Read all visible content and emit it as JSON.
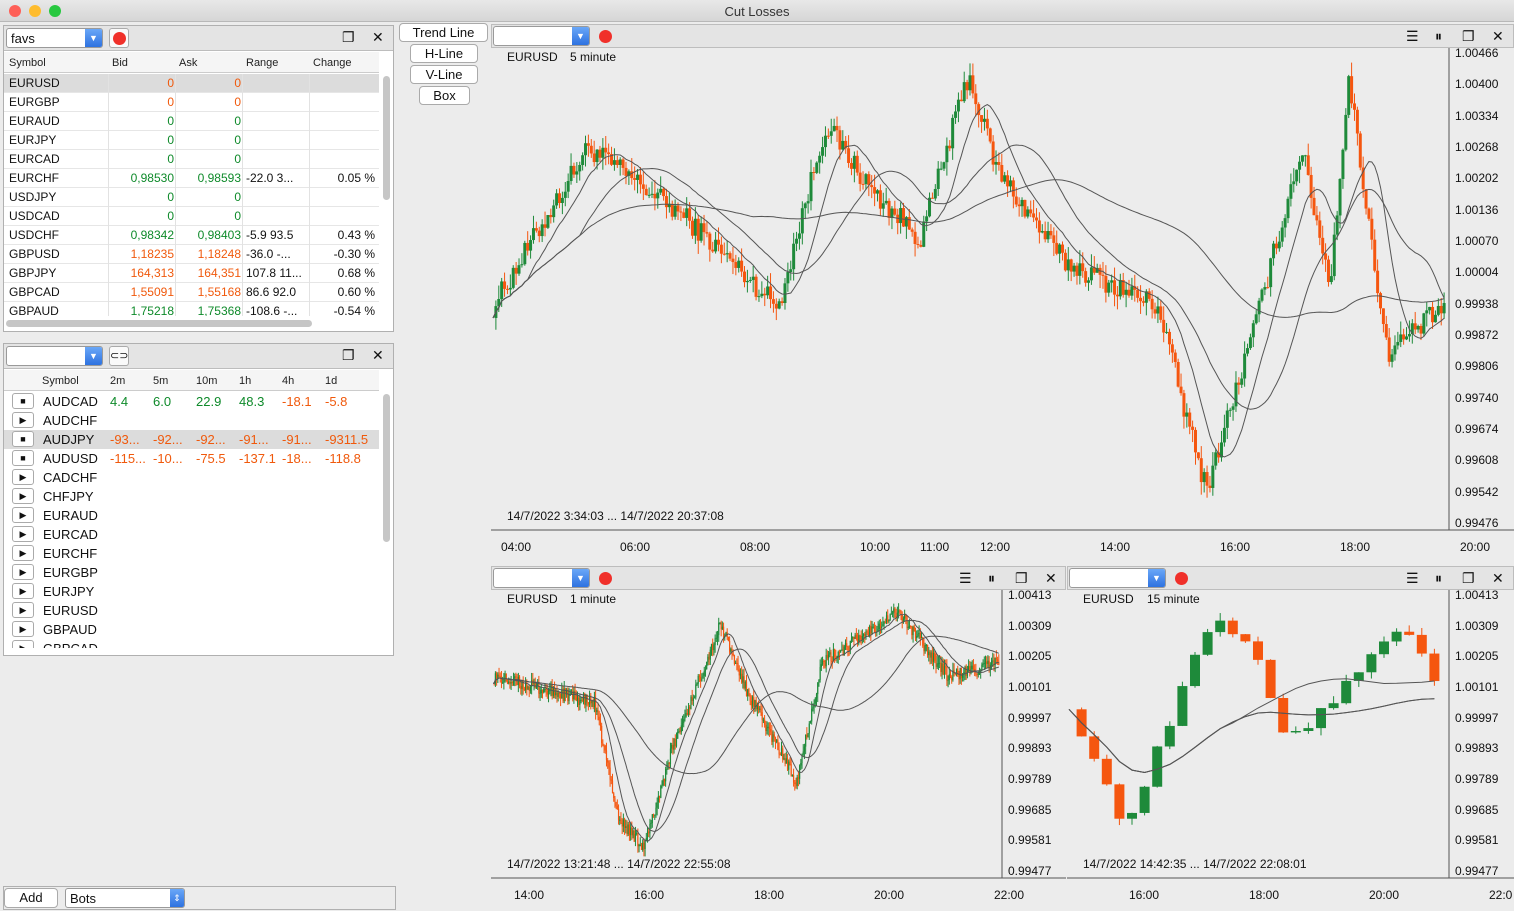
{
  "window": {
    "title": "Cut Losses"
  },
  "favs": {
    "dropdown_value": "favs",
    "columns": [
      "Symbol",
      "Bid",
      "Ask",
      "Range",
      "Change"
    ],
    "rows": [
      {
        "symbol": "EURUSD",
        "bid": "0",
        "ask": "0",
        "range": "",
        "change": "",
        "color": "o"
      },
      {
        "symbol": "EURGBP",
        "bid": "0",
        "ask": "0",
        "range": "",
        "change": "",
        "color": "o"
      },
      {
        "symbol": "EURAUD",
        "bid": "0",
        "ask": "0",
        "range": "",
        "change": "",
        "color": "g"
      },
      {
        "symbol": "EURJPY",
        "bid": "0",
        "ask": "0",
        "range": "",
        "change": "",
        "color": "g"
      },
      {
        "symbol": "EURCAD",
        "bid": "0",
        "ask": "0",
        "range": "",
        "change": "",
        "color": "g"
      },
      {
        "symbol": "EURCHF",
        "bid": "0,98530",
        "ask": "0,98593",
        "range": "-22.0 3...",
        "change": "0.05 %",
        "color": "g"
      },
      {
        "symbol": "USDJPY",
        "bid": "0",
        "ask": "0",
        "range": "",
        "change": "",
        "color": "g"
      },
      {
        "symbol": "USDCAD",
        "bid": "0",
        "ask": "0",
        "range": "",
        "change": "",
        "color": "g"
      },
      {
        "symbol": "USDCHF",
        "bid": "0,98342",
        "ask": "0,98403",
        "range": "-5.9 93.5",
        "change": "0.43 %",
        "color": "g"
      },
      {
        "symbol": "GBPUSD",
        "bid": "1,18235",
        "ask": "1,18248",
        "range": "-36.0 -...",
        "change": "-0.30 %",
        "color": "o"
      },
      {
        "symbol": "GBPJPY",
        "bid": "164,313",
        "ask": "164,351",
        "range": "107.8 11...",
        "change": "0.68 %",
        "color": "o"
      },
      {
        "symbol": "GBPCAD",
        "bid": "1,55091",
        "ask": "1,55168",
        "range": "86.6 92.0",
        "change": "0.60 %",
        "color": "o"
      },
      {
        "symbol": "GBPAUD",
        "bid": "1,75218",
        "ask": "1,75368",
        "range": "-108.6 -...",
        "change": "-0.54 %",
        "color": "g"
      }
    ]
  },
  "scanner": {
    "dropdown_value": "",
    "columns": [
      "Symbol",
      "2m",
      "5m",
      "10m",
      "1h",
      "4h",
      "1d"
    ],
    "rows": [
      {
        "state": "stop",
        "symbol": "AUDCAD",
        "v": [
          "4.4",
          "6.0",
          "22.9",
          "48.3",
          "-18.1",
          "-5.8"
        ],
        "c": [
          "g",
          "g",
          "g",
          "g",
          "o",
          "o"
        ]
      },
      {
        "state": "play",
        "symbol": "AUDCHF",
        "v": [
          "",
          "",
          "",
          "",
          "",
          ""
        ],
        "c": [
          "g",
          "g",
          "g",
          "g",
          "g",
          "g"
        ]
      },
      {
        "state": "stop",
        "symbol": "AUDJPY",
        "v": [
          "-93...",
          "-92...",
          "-92...",
          "-91...",
          "-91...",
          "-9311.5"
        ],
        "c": [
          "o",
          "o",
          "o",
          "o",
          "o",
          "o"
        ]
      },
      {
        "state": "stop",
        "symbol": "AUDUSD",
        "v": [
          "-115...",
          "-10...",
          "-75.5",
          "-137.1",
          "-18...",
          "-118.8"
        ],
        "c": [
          "o",
          "o",
          "o",
          "o",
          "o",
          "o"
        ]
      },
      {
        "state": "play",
        "symbol": "CADCHF",
        "v": [
          "",
          "",
          "",
          "",
          "",
          ""
        ],
        "c": [
          "g",
          "g",
          "g",
          "g",
          "g",
          "g"
        ]
      },
      {
        "state": "play",
        "symbol": "CHFJPY",
        "v": [
          "",
          "",
          "",
          "",
          "",
          ""
        ],
        "c": [
          "g",
          "g",
          "g",
          "g",
          "g",
          "g"
        ]
      },
      {
        "state": "play",
        "symbol": "EURAUD",
        "v": [
          "",
          "",
          "",
          "",
          "",
          ""
        ],
        "c": [
          "g",
          "g",
          "g",
          "g",
          "g",
          "g"
        ]
      },
      {
        "state": "play",
        "symbol": "EURCAD",
        "v": [
          "",
          "",
          "",
          "",
          "",
          ""
        ],
        "c": [
          "g",
          "g",
          "g",
          "g",
          "g",
          "g"
        ]
      },
      {
        "state": "play",
        "symbol": "EURCHF",
        "v": [
          "",
          "",
          "",
          "",
          "",
          ""
        ],
        "c": [
          "g",
          "g",
          "g",
          "g",
          "g",
          "g"
        ]
      },
      {
        "state": "play",
        "symbol": "EURGBP",
        "v": [
          "",
          "",
          "",
          "",
          "",
          ""
        ],
        "c": [
          "g",
          "g",
          "g",
          "g",
          "g",
          "g"
        ]
      },
      {
        "state": "play",
        "symbol": "EURJPY",
        "v": [
          "",
          "",
          "",
          "",
          "",
          ""
        ],
        "c": [
          "g",
          "g",
          "g",
          "g",
          "g",
          "g"
        ]
      },
      {
        "state": "play",
        "symbol": "EURUSD",
        "v": [
          "",
          "",
          "",
          "",
          "",
          ""
        ],
        "c": [
          "g",
          "g",
          "g",
          "g",
          "g",
          "g"
        ]
      },
      {
        "state": "play",
        "symbol": "GBPAUD",
        "v": [
          "",
          "",
          "",
          "",
          "",
          ""
        ],
        "c": [
          "g",
          "g",
          "g",
          "g",
          "g",
          "g"
        ]
      },
      {
        "state": "play",
        "symbol": "GBPCAD",
        "v": [
          "",
          "",
          "",
          "",
          "",
          ""
        ],
        "c": [
          "g",
          "g",
          "g",
          "g",
          "g",
          "g"
        ]
      }
    ]
  },
  "bottom": {
    "add_label": "Add",
    "bots_value": "Bots"
  },
  "tools": {
    "trend_line": "Trend Line",
    "h_line": "H-Line",
    "v_line": "V-Line",
    "box": "Box"
  },
  "charts": {
    "main": {
      "symbol": "EURUSD",
      "timeframe": "5 minute",
      "range": "14/7/2022 3:34:03 ... 14/7/2022 20:37:08",
      "yticks": [
        "1.00466",
        "1.00400",
        "1.00334",
        "1.00268",
        "1.00202",
        "1.00136",
        "1.00070",
        "1.00004",
        "0.99938",
        "0.99872",
        "0.99806",
        "0.99740",
        "0.99674",
        "0.99608",
        "0.99542",
        "0.99476"
      ],
      "xticks": [
        "04:00",
        "06:00",
        "08:00",
        "10:00",
        "11:00",
        "12:00",
        "14:00",
        "16:00",
        "18:00",
        "20:00"
      ]
    },
    "m1": {
      "symbol": "EURUSD",
      "timeframe": "1 minute",
      "range": "14/7/2022 13:21:48 ... 14/7/2022 22:55:08",
      "yticks": [
        "1.00413",
        "1.00309",
        "1.00205",
        "1.00101",
        "0.99997",
        "0.99893",
        "0.99789",
        "0.99685",
        "0.99581",
        "0.99477"
      ],
      "xticks": [
        "14:00",
        "16:00",
        "18:00",
        "20:00",
        "22:00"
      ]
    },
    "m15": {
      "symbol": "EURUSD",
      "timeframe": "15 minute",
      "range": "14/7/2022 14:42:35 ... 14/7/2022 22:08:01",
      "yticks": [
        "1.00413",
        "1.00309",
        "1.00205",
        "1.00101",
        "0.99997",
        "0.99893",
        "0.99789",
        "0.99685",
        "0.99581",
        "0.99477"
      ],
      "xticks": [
        "16:00",
        "18:00",
        "20:00",
        "22:0"
      ]
    }
  },
  "colors": {
    "up": "#1e8a3a",
    "down": "#f5560f",
    "record": "#f0302a",
    "dropdown_arrow": "#3b7fe8"
  }
}
